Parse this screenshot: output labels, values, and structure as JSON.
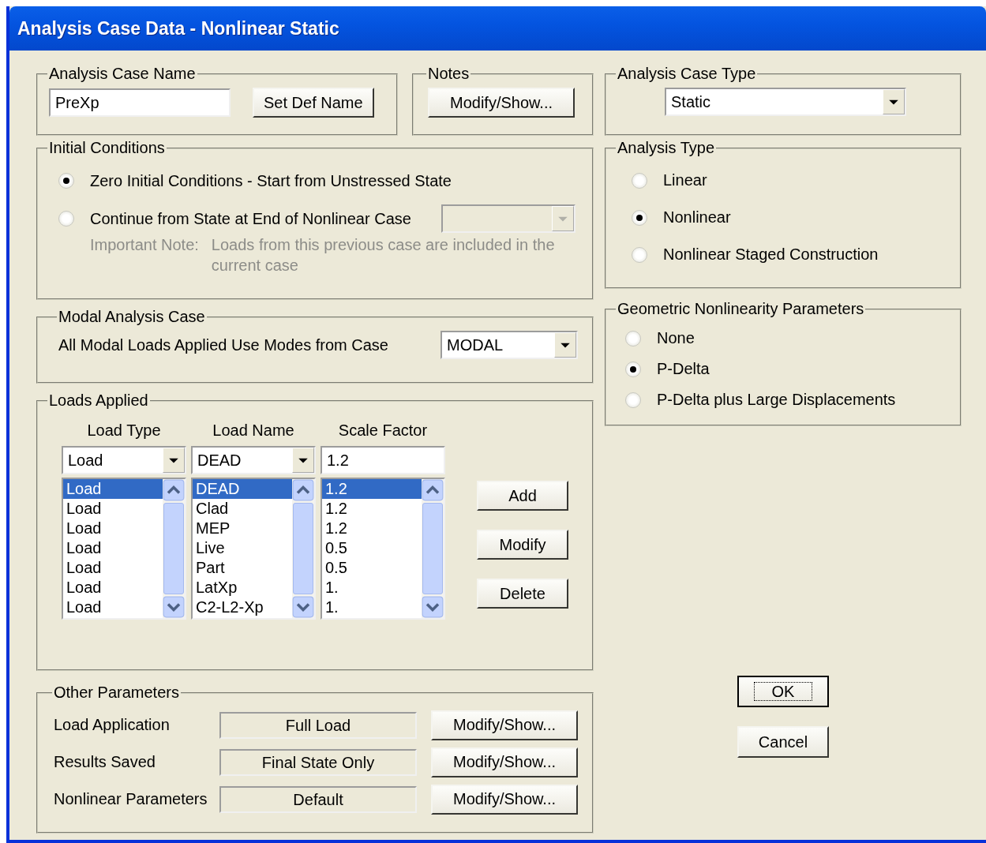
{
  "window": {
    "title": "Analysis Case Data - Nonlinear Static"
  },
  "case_name": {
    "title": "Analysis Case Name",
    "value": "PreXp",
    "button": "Set Def Name"
  },
  "notes": {
    "title": "Notes",
    "button": "Modify/Show..."
  },
  "case_type": {
    "title": "Analysis Case Type",
    "value": "Static"
  },
  "initial_conditions": {
    "title": "Initial Conditions",
    "options": [
      {
        "label": "Zero Initial Conditions - Start from Unstressed State",
        "selected": true
      },
      {
        "label": "Continue from State at End of Nonlinear Case",
        "selected": false
      }
    ],
    "dropdown_disabled": true,
    "note_label": "Important Note:",
    "note_text": "Loads from this previous case are included in the current case"
  },
  "analysis_type": {
    "title": "Analysis Type",
    "options": [
      {
        "label": "Linear",
        "selected": false
      },
      {
        "label": "Nonlinear",
        "selected": true
      },
      {
        "label": "Nonlinear Staged Construction",
        "selected": false
      }
    ]
  },
  "modal": {
    "title": "Modal Analysis Case",
    "label": "All Modal Loads Applied Use Modes from Case",
    "value": "MODAL"
  },
  "geometric": {
    "title": "Geometric Nonlinearity Parameters",
    "options": [
      {
        "label": "None",
        "selected": false
      },
      {
        "label": "P-Delta",
        "selected": true
      },
      {
        "label": "P-Delta plus Large Displacements",
        "selected": false
      }
    ]
  },
  "loads": {
    "title": "Loads Applied",
    "columns": [
      "Load Type",
      "Load Name",
      "Scale Factor"
    ],
    "entry": {
      "type": "Load",
      "name": "DEAD",
      "scale": "1.2"
    },
    "rows": [
      {
        "type": "Load",
        "name": "DEAD",
        "scale": "1.2",
        "selected": true
      },
      {
        "type": "Load",
        "name": "Clad",
        "scale": "1.2",
        "selected": false
      },
      {
        "type": "Load",
        "name": "MEP",
        "scale": "1.2",
        "selected": false
      },
      {
        "type": "Load",
        "name": "Live",
        "scale": "0.5",
        "selected": false
      },
      {
        "type": "Load",
        "name": "Part",
        "scale": "0.5",
        "selected": false
      },
      {
        "type": "Load",
        "name": "LatXp",
        "scale": "1.",
        "selected": false
      },
      {
        "type": "Load",
        "name": "C2-L2-Xp",
        "scale": "1.",
        "selected": false
      }
    ],
    "buttons": [
      "Add",
      "Modify",
      "Delete"
    ]
  },
  "other": {
    "title": "Other Parameters",
    "rows": [
      {
        "label": "Load Application",
        "value": "Full Load",
        "button": "Modify/Show..."
      },
      {
        "label": "Results Saved",
        "value": "Final State Only",
        "button": "Modify/Show..."
      },
      {
        "label": "Nonlinear Parameters",
        "value": "Default",
        "button": "Modify/Show..."
      }
    ]
  },
  "buttons": [
    {
      "label": "OK",
      "default": true
    },
    {
      "label": "Cancel",
      "default": false
    }
  ]
}
